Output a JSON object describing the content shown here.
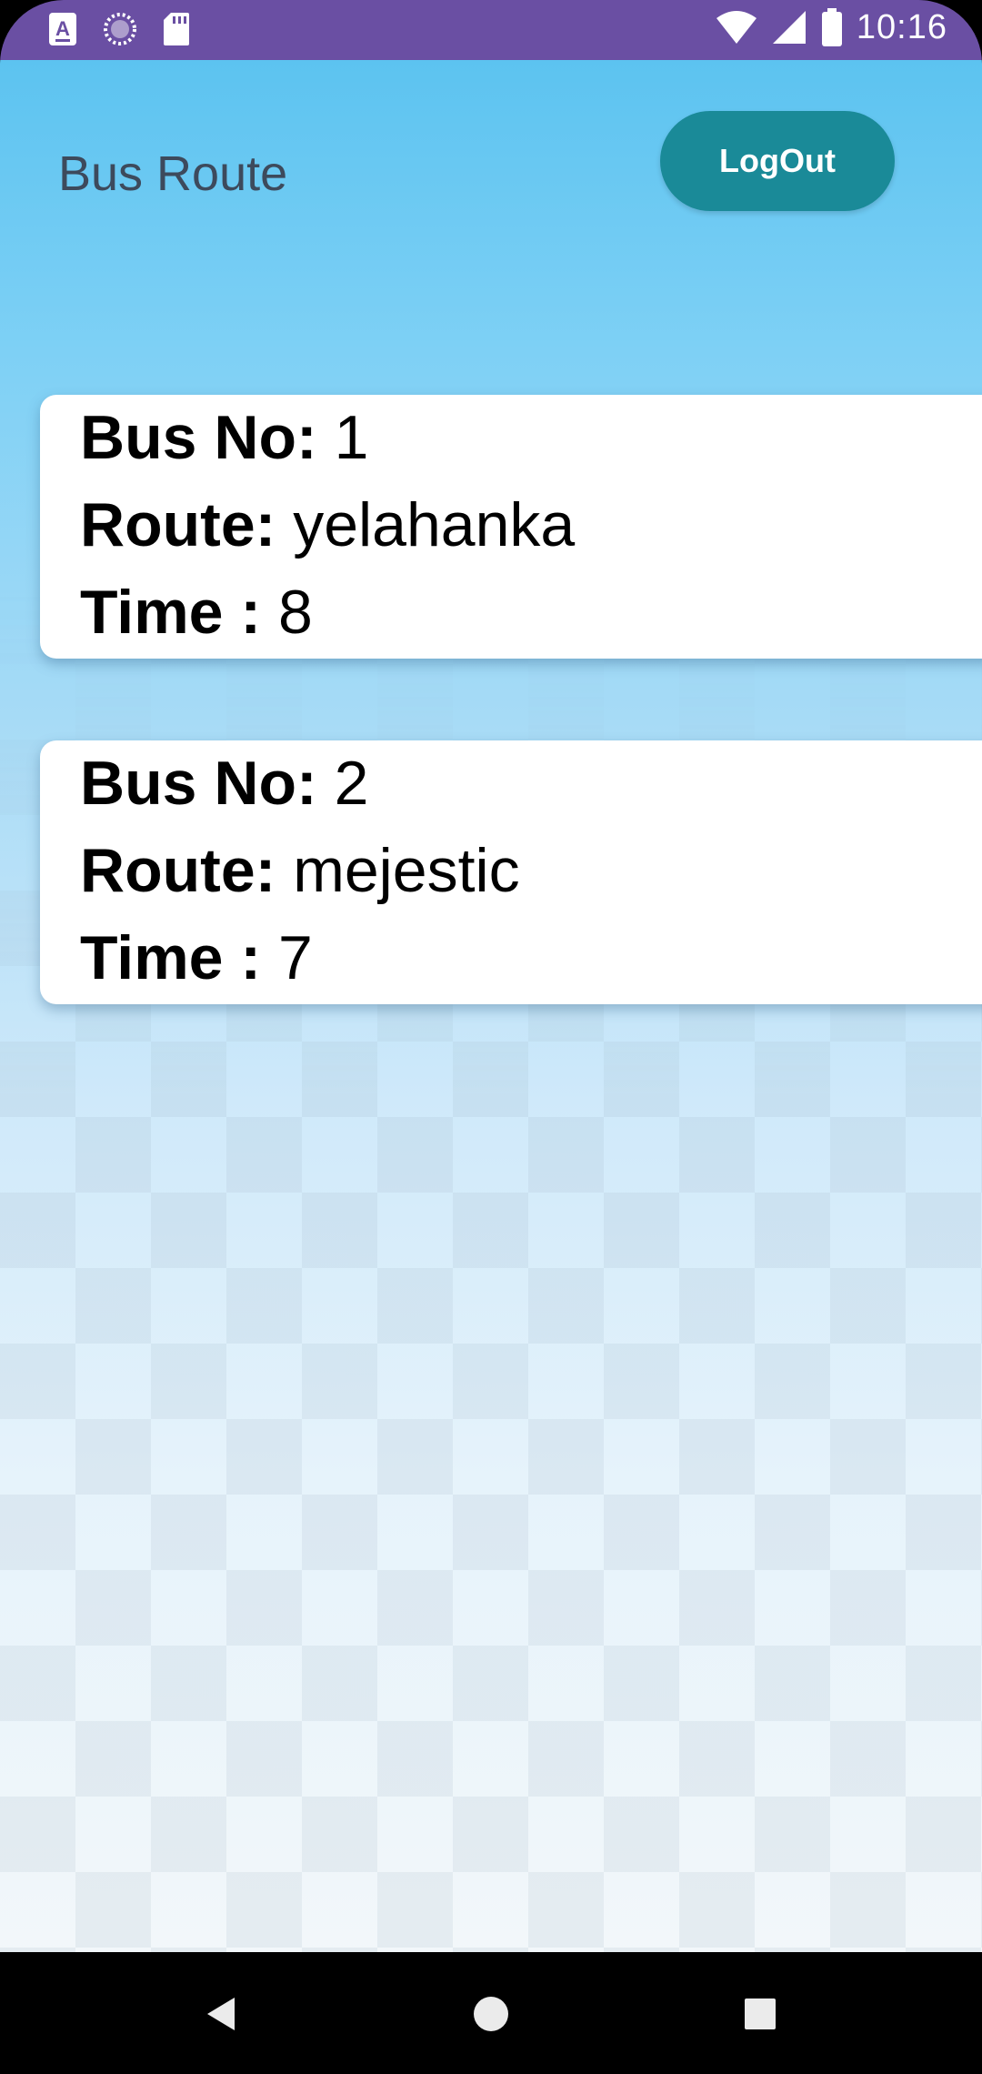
{
  "status_bar": {
    "time": "10:16",
    "icons": [
      "text-input-a-icon",
      "loading-circle-icon",
      "sd-card-icon",
      "wifi-icon",
      "signal-icon",
      "battery-icon"
    ]
  },
  "header": {
    "title": "Bus Route",
    "logout_label": "LogOut"
  },
  "labels": {
    "bus_no": "Bus No:",
    "route": "Route:",
    "time": "Time :"
  },
  "buses": [
    {
      "bus_no": "1",
      "route": "yelahanka",
      "time": "8"
    },
    {
      "bus_no": "2",
      "route": "mejestic",
      "time": "7"
    }
  ],
  "nav_bar": {
    "icons": [
      "back-icon",
      "home-icon",
      "recents-icon"
    ]
  },
  "colors": {
    "status_bar": "#6a4fa3",
    "accent": "#1a8a98",
    "background_top": "#5cc3f0",
    "card": "#ffffff"
  }
}
